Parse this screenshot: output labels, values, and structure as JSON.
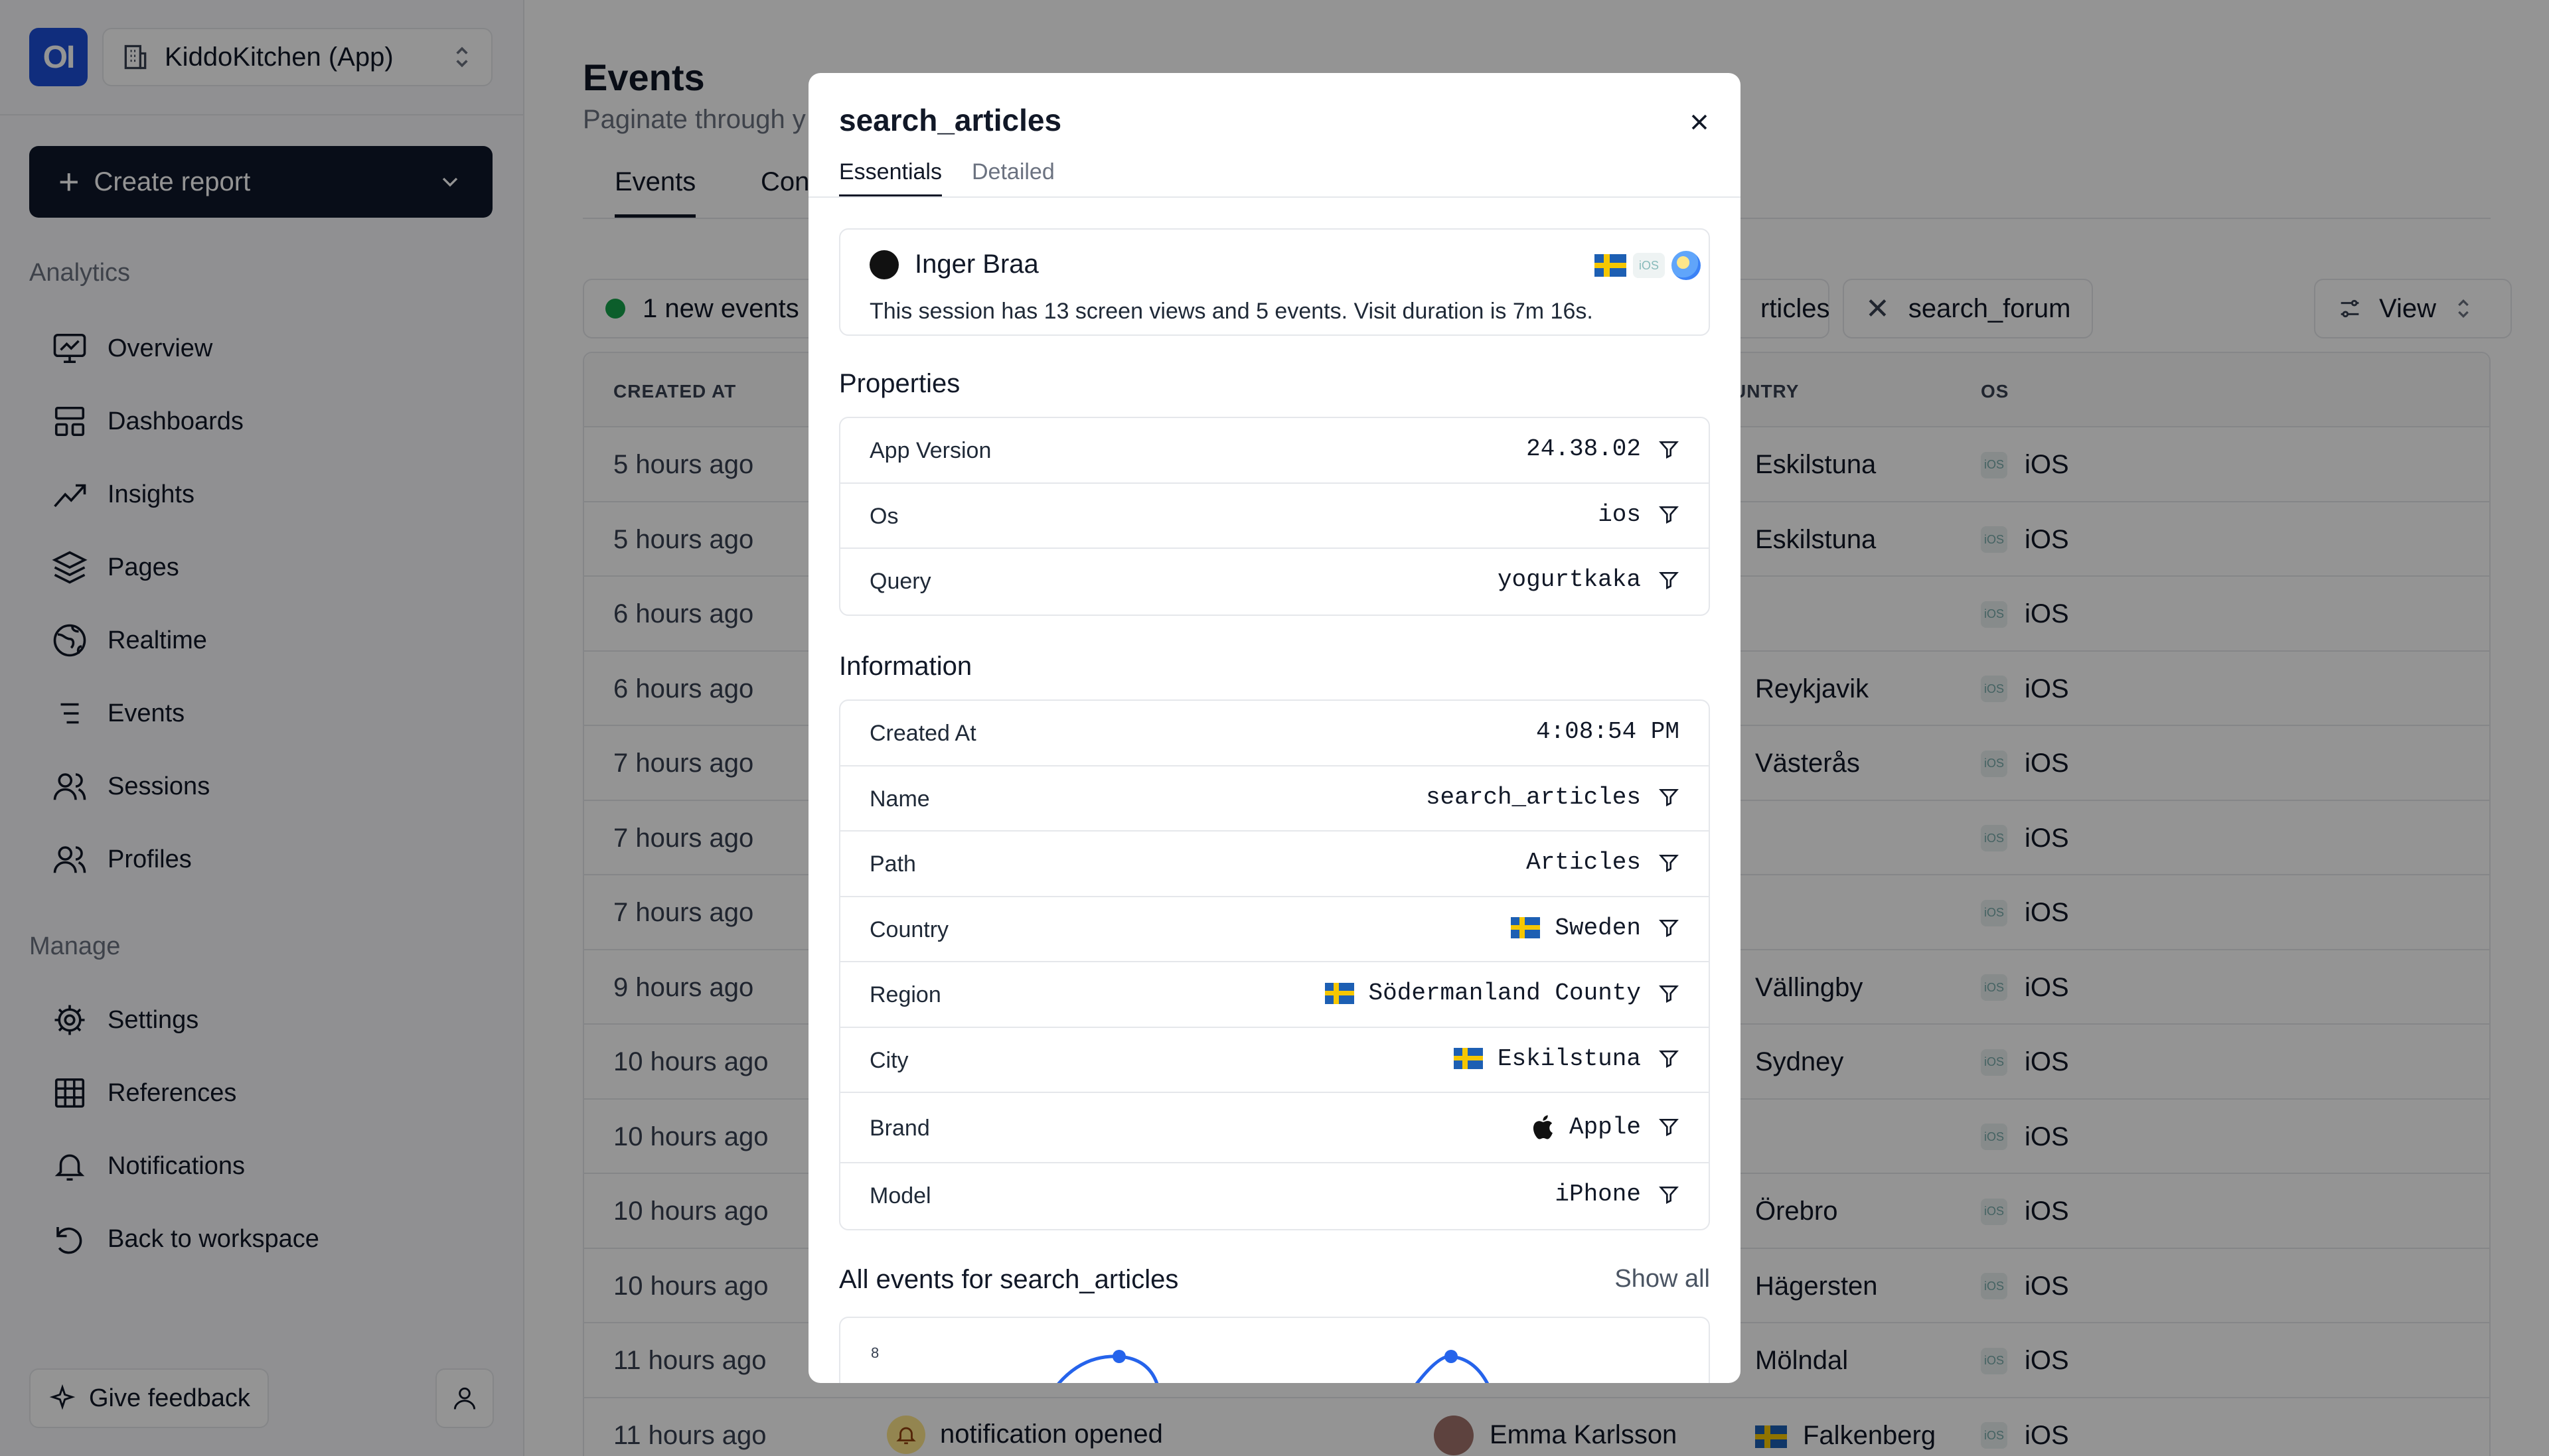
{
  "workspace": {
    "logo_text": "OI",
    "project": "KiddoKitchen (App)"
  },
  "sidebar": {
    "create_report": "Create report",
    "analytics_label": "Analytics",
    "analytics_items": [
      {
        "label": "Overview",
        "icon": "monitor-chart-icon"
      },
      {
        "label": "Dashboards",
        "icon": "layout-icon"
      },
      {
        "label": "Insights",
        "icon": "trend-icon"
      },
      {
        "label": "Pages",
        "icon": "layers-icon"
      },
      {
        "label": "Realtime",
        "icon": "globe-icon"
      },
      {
        "label": "Events",
        "icon": "list-icon"
      },
      {
        "label": "Sessions",
        "icon": "users-icon"
      },
      {
        "label": "Profiles",
        "icon": "users-icon"
      }
    ],
    "manage_label": "Manage",
    "manage_items": [
      {
        "label": "Settings",
        "icon": "gear-icon"
      },
      {
        "label": "References",
        "icon": "grid-icon"
      },
      {
        "label": "Notifications",
        "icon": "bell-icon"
      },
      {
        "label": "Back to workspace",
        "icon": "undo-icon"
      }
    ],
    "feedback": "Give feedback"
  },
  "main": {
    "title": "Events",
    "subtitle": "Paginate through y",
    "tabs": [
      "Events",
      "Con"
    ],
    "new_events": "1 new events",
    "filter_chip_1": "rticles",
    "filter_chip_2": "search_forum",
    "view_label": "View",
    "columns": {
      "created_at": "CREATED AT",
      "country": "UNTRY",
      "os": "OS"
    },
    "rows": [
      {
        "time": "5 hours ago",
        "city": "Eskilstuna",
        "os": "iOS"
      },
      {
        "time": "5 hours ago",
        "city": "Eskilstuna",
        "os": "iOS"
      },
      {
        "time": "6 hours ago",
        "city": "",
        "os": "iOS"
      },
      {
        "time": "6 hours ago",
        "city": "Reykjavik",
        "os": "iOS"
      },
      {
        "time": "7 hours ago",
        "city": "Västerås",
        "os": "iOS"
      },
      {
        "time": "7 hours ago",
        "city": "",
        "os": "iOS"
      },
      {
        "time": "7 hours ago",
        "city": "",
        "os": "iOS"
      },
      {
        "time": "9 hours ago",
        "city": "Vällingby",
        "os": "iOS"
      },
      {
        "time": "10 hours ago",
        "city": "Sydney",
        "os": "iOS"
      },
      {
        "time": "10 hours ago",
        "city": "",
        "os": "iOS"
      },
      {
        "time": "10 hours ago",
        "city": "Örebro",
        "os": "iOS"
      },
      {
        "time": "10 hours ago",
        "city": "Hägersten",
        "os": "iOS"
      },
      {
        "time": "11 hours ago",
        "city": "Mölndal",
        "os": "iOS"
      },
      {
        "time": "11 hours ago",
        "city": "Falkenberg",
        "os": "iOS",
        "event": "notification opened",
        "profile": "Emma Karlsson"
      }
    ]
  },
  "modal": {
    "title": "search_articles",
    "tabs": {
      "essentials": "Essentials",
      "detailed": "Detailed"
    },
    "session": {
      "name": "Inger Braa",
      "summary": "This session has 13 screen views and 5 events. Visit duration is 7m 16s."
    },
    "properties_label": "Properties",
    "properties": [
      {
        "key": "App Version",
        "value": "24.38.02"
      },
      {
        "key": "Os",
        "value": "ios"
      },
      {
        "key": "Query",
        "value": "yogurtkaka"
      }
    ],
    "information_label": "Information",
    "information": [
      {
        "key": "Created At",
        "value": "4:08:54 PM"
      },
      {
        "key": "Name",
        "value": "search_articles"
      },
      {
        "key": "Path",
        "value": "Articles"
      },
      {
        "key": "Country",
        "value": "Sweden"
      },
      {
        "key": "Region",
        "value": "Södermanland County"
      },
      {
        "key": "City",
        "value": "Eskilstuna"
      },
      {
        "key": "Brand",
        "value": "Apple"
      },
      {
        "key": "Model",
        "value": "iPhone"
      }
    ],
    "all_events_label": "All events for search_articles",
    "show_all": "Show all",
    "chart_y_tick": "8"
  },
  "colors": {
    "accent": "#1d4ed8",
    "primary_button": "#0f172a",
    "live_dot": "#16a34a",
    "chart_line": "#2563eb"
  }
}
